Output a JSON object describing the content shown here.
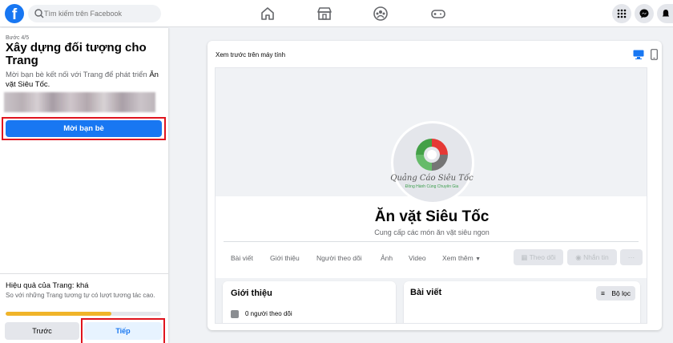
{
  "topbar": {
    "logo_letter": "f",
    "search_placeholder": "Tìm kiếm trên Facebook",
    "brand_color": "#1877f2"
  },
  "sidebar": {
    "step": "Bước 4/5",
    "title": "Xây dựng đối tượng cho Trang",
    "desc_prefix": "Mời bạn bè kết nối với Trang để phát triển",
    "page_name": "Ăn vặt Siêu Tốc.",
    "invite_label": "Mời bạn bè",
    "performance_title": "Hiệu quả của Trang: khá",
    "performance_desc": "So với những Trang tương tự có lượt tương tác cao.",
    "progress_fraction": 0.68,
    "prev_label": "Trước",
    "next_label": "Tiếp",
    "highlight_color": "#e0141e"
  },
  "preview": {
    "label": "Xem trước trên máy tính",
    "avatar_text": "Quảng Cáo Siêu Tốc",
    "avatar_subtext": "Đồng Hành Cùng Chuyên Gia",
    "page_name": "Ăn vặt Siêu Tốc",
    "page_description": "Cung cấp các món ăn vặt siêu ngon",
    "tabs": [
      "Bài viết",
      "Giới thiệu",
      "Người theo dõi",
      "Ảnh",
      "Video",
      "Xem thêm"
    ],
    "follow_button": "Theo dõi",
    "message_button": "Nhắn tin",
    "more_button": "···",
    "intro_title": "Giới thiệu",
    "followers_text": "0 người theo dõi",
    "posts_title": "Bài viết",
    "filter_label": "Bộ lọc"
  }
}
